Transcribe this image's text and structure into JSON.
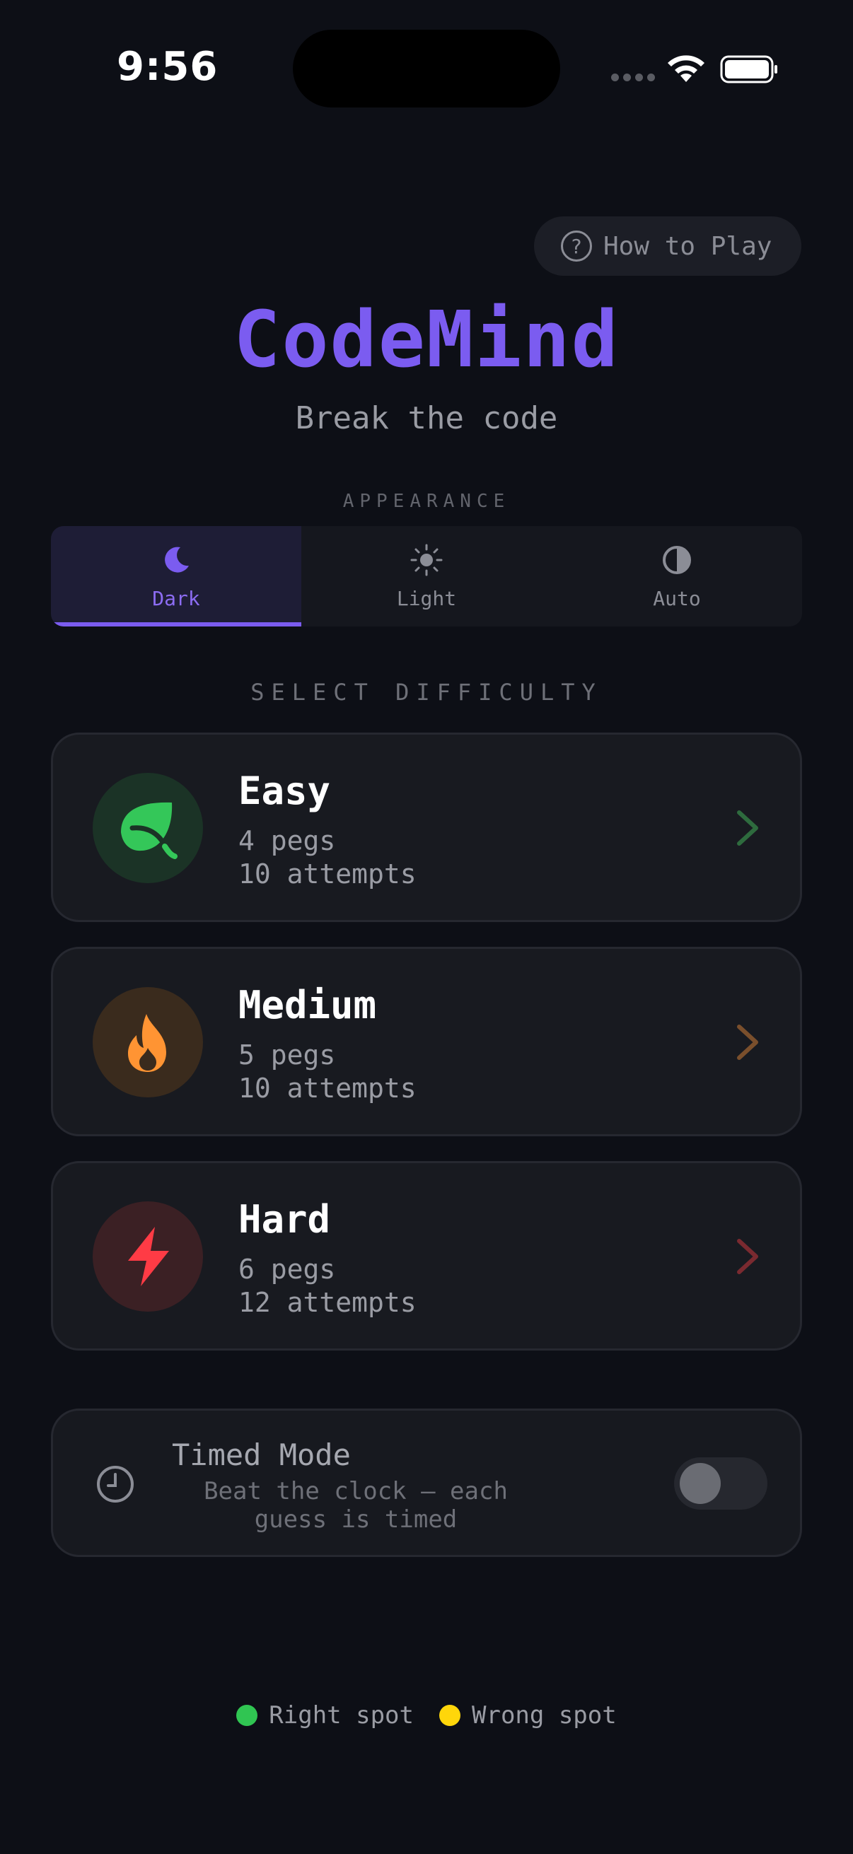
{
  "status_bar": {
    "time": "9:56"
  },
  "header": {
    "how_to_play": "How to Play",
    "title": "CodeMind",
    "subtitle": "Break the code"
  },
  "appearance": {
    "label": "APPEARANCE",
    "options": [
      {
        "label": "Dark",
        "icon": "moon-icon",
        "selected": true
      },
      {
        "label": "Light",
        "icon": "sun-icon",
        "selected": false
      },
      {
        "label": "Auto",
        "icon": "half-circle-icon",
        "selected": false
      }
    ]
  },
  "difficulty": {
    "label": "SELECT DIFFICULTY",
    "levels": [
      {
        "name": "Easy",
        "pegs": "4 pegs",
        "attempts": "10 attempts",
        "icon": "leaf-icon",
        "color": "#34c759"
      },
      {
        "name": "Medium",
        "pegs": "5 pegs",
        "attempts": "10 attempts",
        "icon": "flame-icon",
        "color": "#ff9433"
      },
      {
        "name": "Hard",
        "pegs": "6 pegs",
        "attempts": "12 attempts",
        "icon": "lightning-icon",
        "color": "#ff3b45"
      }
    ]
  },
  "timed_mode": {
    "title": "Timed Mode",
    "description": "Beat the clock — each guess is timed",
    "enabled": false
  },
  "legend": {
    "right_spot": "Right spot",
    "wrong_spot": "Wrong spot",
    "right_color": "#30c552",
    "wrong_color": "#ffd60a"
  },
  "colors": {
    "accent": "#7b5cf0",
    "background": "#0d0f16"
  }
}
